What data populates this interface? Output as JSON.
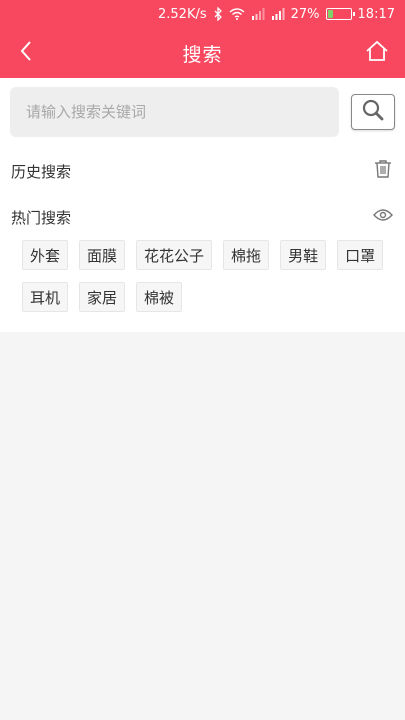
{
  "status_bar": {
    "speed": "2.52K/s",
    "battery_percent": "27%",
    "battery_level": 0.27,
    "time": "18:17",
    "icons": [
      "bluetooth-icon",
      "wifi-icon",
      "signal-icon",
      "signal-icon",
      "battery-icon"
    ]
  },
  "header": {
    "title": "搜索",
    "back_icon": "chevron-left-icon",
    "home_icon": "home-icon",
    "background_color": "#f7485f"
  },
  "search": {
    "placeholder": "请输入搜索关键词",
    "value": "",
    "button_icon": "search-icon"
  },
  "history": {
    "label": "历史搜索",
    "action_icon": "trash-icon",
    "items": []
  },
  "hot": {
    "label": "热门搜索",
    "action_icon": "eye-icon",
    "tags": [
      "外套",
      "面膜",
      "花花公子",
      "棉拖",
      "男鞋",
      "口罩",
      "耳机",
      "家居",
      "棉被"
    ]
  }
}
